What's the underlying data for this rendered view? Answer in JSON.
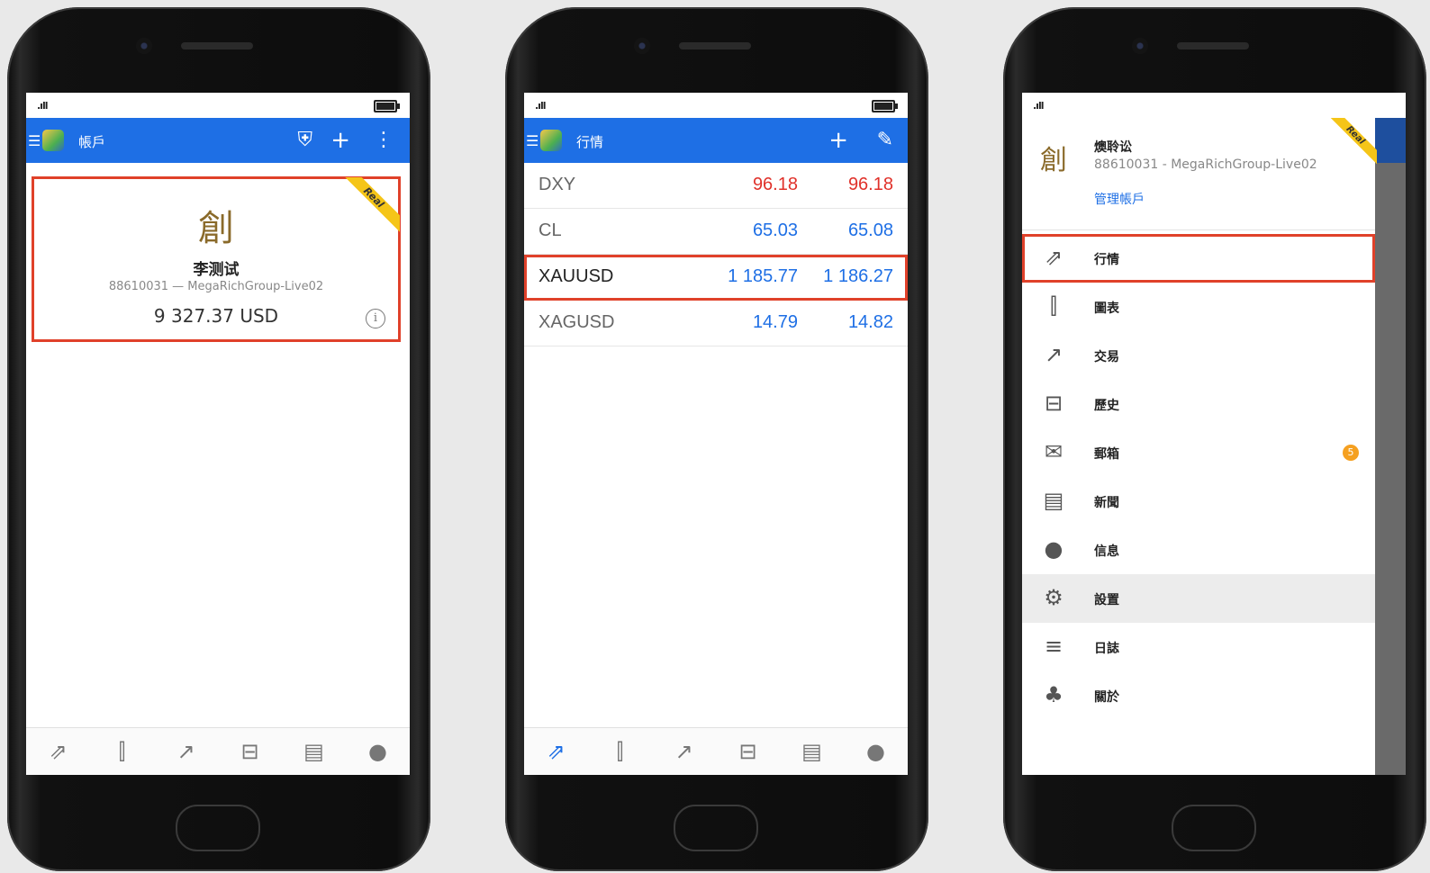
{
  "phone1": {
    "title": "帳戶",
    "card": {
      "badge": "Real",
      "seal": "創",
      "name": "李测试",
      "login": "88610031 — MegaRichGroup-Live02",
      "balance": "9 327.37 USD"
    }
  },
  "phone2": {
    "title": "行情",
    "quotes": [
      {
        "symbol": "DXY",
        "bid": "96.18",
        "ask": "96.18",
        "color": "#e0312a"
      },
      {
        "symbol": "CL",
        "bid": "65.03",
        "ask": "65.08",
        "color": "#1e6fe5"
      },
      {
        "symbol": "XAUUSD",
        "bid": "1 185.77",
        "ask": "1 186.27",
        "color": "#1e6fe5"
      },
      {
        "symbol": "XAGUSD",
        "bid": "14.79",
        "ask": "14.82",
        "color": "#1e6fe5"
      }
    ]
  },
  "phone3": {
    "drawer": {
      "seal": "創",
      "name": "燠聆讼",
      "login": "88610031 - MegaRichGroup-Live02",
      "manage": "管理帳戶",
      "badge": "Real"
    },
    "menu": [
      {
        "label": "行情",
        "icon": "quotes-icon"
      },
      {
        "label": "圖表",
        "icon": "chart-icon"
      },
      {
        "label": "交易",
        "icon": "trade-icon"
      },
      {
        "label": "歷史",
        "icon": "history-icon"
      },
      {
        "label": "郵箱",
        "icon": "mailbox-icon",
        "badge": "5"
      },
      {
        "label": "新聞",
        "icon": "news-icon"
      },
      {
        "label": "信息",
        "icon": "messages-icon"
      },
      {
        "label": "設置",
        "icon": "settings-icon"
      },
      {
        "label": "日誌",
        "icon": "journal-icon"
      },
      {
        "label": "關於",
        "icon": "about-icon"
      }
    ]
  },
  "colors": {
    "accent": "#1e6fe5",
    "highlight": "#e0412a",
    "ribbon": "#f5c518"
  }
}
